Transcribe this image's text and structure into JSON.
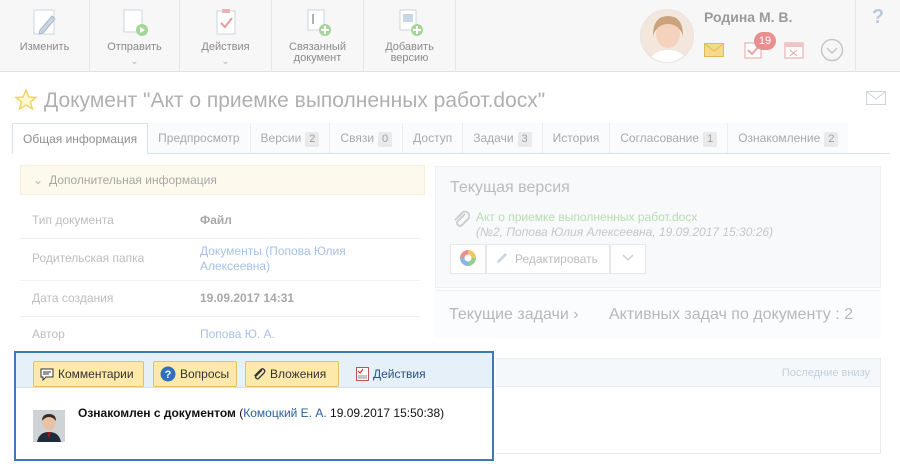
{
  "toolbar": {
    "edit": "Изменить",
    "send": "Отправить",
    "actions": "Действия",
    "linked_doc_1": "Связанный",
    "linked_doc_2": "документ",
    "add_version_1": "Добавить",
    "add_version_2": "версию"
  },
  "user": {
    "name": "Родина М. В.",
    "tasks_badge": "19"
  },
  "help_label": "?",
  "document": {
    "title": "Документ \"Акт о приемке выполненных работ.docx\""
  },
  "tabs": [
    {
      "label": "Общая информация",
      "count": ""
    },
    {
      "label": "Предпросмотр",
      "count": ""
    },
    {
      "label": "Версии",
      "count": "2"
    },
    {
      "label": "Связи",
      "count": "0"
    },
    {
      "label": "Доступ",
      "count": ""
    },
    {
      "label": "Задачи",
      "count": "3"
    },
    {
      "label": "История",
      "count": ""
    },
    {
      "label": "Согласование",
      "count": "1"
    },
    {
      "label": "Ознакомление",
      "count": "2"
    }
  ],
  "info": {
    "section_title": "Дополнительная информация",
    "doc_type_label": "Тип документа",
    "doc_type_value": "Файл",
    "parent_folder_label": "Родительская папка",
    "parent_folder_value": "Документы (Попова Юлия Алексеевна)",
    "created_label": "Дата создания",
    "created_value": "19.09.2017 14:31",
    "author_label": "Автор",
    "author_value": "Попова Ю. А."
  },
  "version": {
    "title": "Текущая версия",
    "file_link": "Акт о приемке выполненных работ.docx",
    "meta": "(№2, Попова Юлия Алексеевна, 19.09.2017 15:30:26)",
    "edit_label": "Редактировать"
  },
  "tasks": {
    "current": "Текущие задачи",
    "active": "Активных задач по документу : 2"
  },
  "comments": {
    "comments_btn": "Комментарии",
    "questions_btn": "Вопросы",
    "attachments_btn": "Вложения",
    "actions_link": "Действия",
    "last_at_bottom": "Последние внизу",
    "entry_text": "Ознакомлен с документом",
    "entry_open": " (",
    "entry_author": "Комоцкий Е. А.",
    "entry_date": " 19.09.2017 15:50:38)"
  },
  "colors": {
    "highlight_border": "#3e78b6",
    "yellow_button": "#fde9a9",
    "link": "#2c5e9b"
  }
}
